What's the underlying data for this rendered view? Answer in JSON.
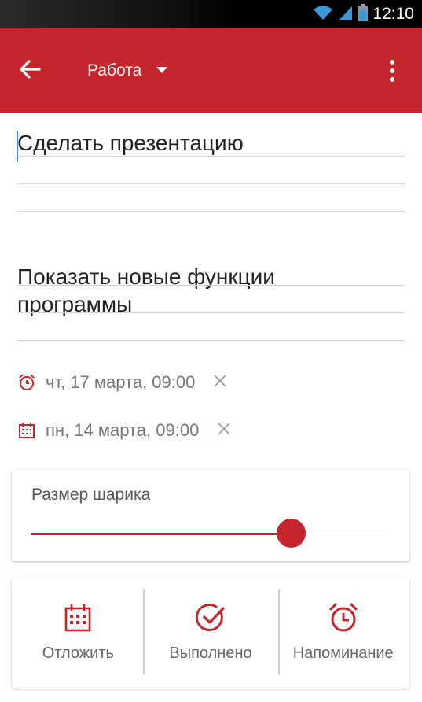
{
  "status_bar": {
    "time": "12:10",
    "icons": [
      "wifi-icon",
      "signal-icon",
      "battery-icon"
    ]
  },
  "toolbar": {
    "category": "Работа",
    "icons": [
      "back-arrow-icon",
      "dropdown-triangle-icon",
      "more-vert-icon"
    ],
    "color": "#c4262b"
  },
  "task": {
    "title": "Сделать презентацию",
    "note": "Показать новые функции программы"
  },
  "dates": [
    {
      "icon": "alarm-clock-icon",
      "text": "чт, 17 марта, 09:00"
    },
    {
      "icon": "calendar-icon",
      "text": "пн, 14 марта, 09:00"
    }
  ],
  "bubble_size": {
    "label": "Размер шарика",
    "value_fraction": 0.72
  },
  "actions": [
    {
      "label": "Отложить",
      "icon": "calendar-icon"
    },
    {
      "label": "Выполнено",
      "icon": "check-circle-icon"
    },
    {
      "label": "Напоминание",
      "icon": "alarm-clock-icon"
    }
  ]
}
